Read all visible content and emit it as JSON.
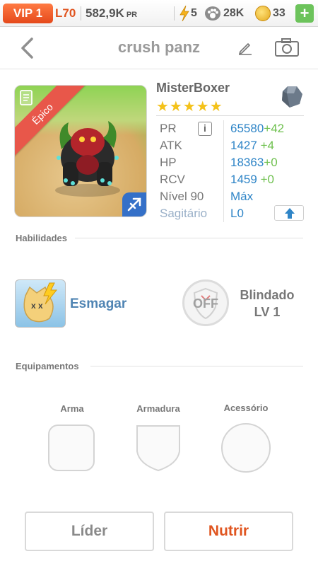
{
  "status_bar": {
    "vip": "VIP 1",
    "level": "L70",
    "power": "582,9K",
    "power_unit": "PR",
    "energy": "5",
    "paws": "28K",
    "coins": "33",
    "plus": "+"
  },
  "header": {
    "title": "crush panz"
  },
  "pet": {
    "rarity": "Épico",
    "name": "MisterBoxer",
    "stars": "★★★★★",
    "star_count": 5,
    "stats": {
      "pr_label": "PR",
      "pr_value": "65580",
      "pr_bonus": "+42",
      "atk_label": "ATK",
      "atk_value": "1427",
      "atk_bonus": "+4",
      "hp_label": "HP",
      "hp_value": "18363",
      "hp_bonus": "+0",
      "rcv_label": "RCV",
      "rcv_value": "1459",
      "rcv_bonus": "+0",
      "level_label": "Nível 90",
      "level_value": "Máx",
      "sign_label": "Sagitário",
      "sign_value": "L0"
    },
    "info": "i"
  },
  "skills": {
    "section_title": "Habilidades",
    "active_name": "Esmagar",
    "passive_state": "OFF",
    "passive_name": "Blindado",
    "passive_level": "LV 1"
  },
  "equipment": {
    "section_title": "Equipamentos",
    "weapon": "Arma",
    "armor": "Armadura",
    "accessory": "Acessório"
  },
  "actions": {
    "leader": "Líder",
    "feed": "Nutrir"
  },
  "colors": {
    "accent_orange": "#e05520",
    "stat_blue": "#2f85c7",
    "bonus_green": "#6ec04e",
    "star_yellow": "#f4c21a",
    "epic_red": "#e8574a"
  }
}
